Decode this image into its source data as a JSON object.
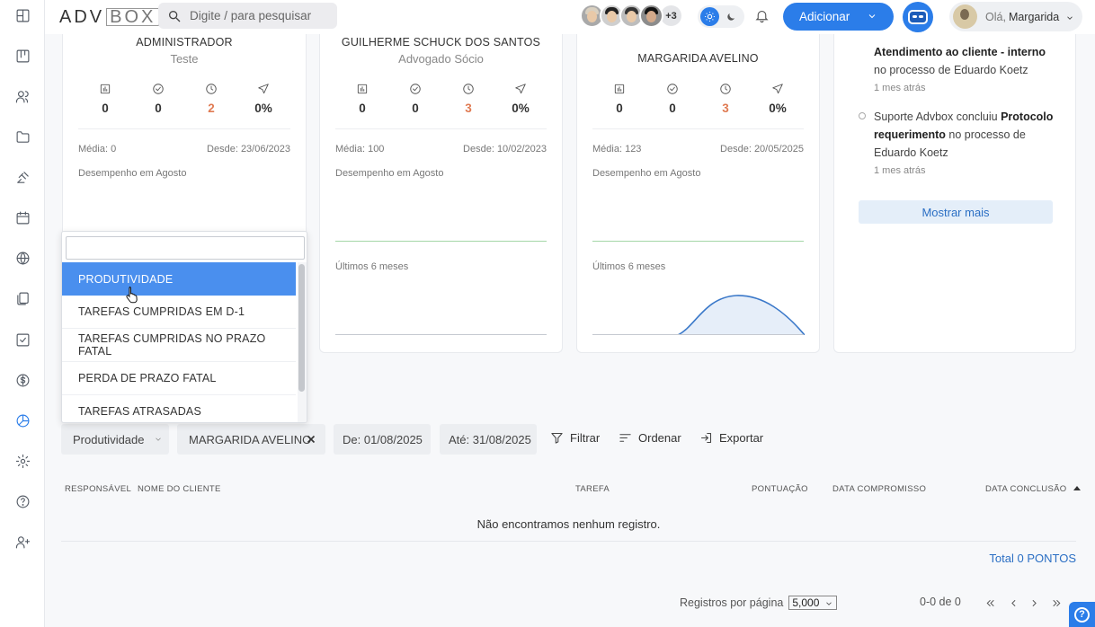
{
  "topbar": {
    "logo_main": "ADV",
    "logo_box": "BOX",
    "search_placeholder": "Digite / para pesquisar",
    "extra_users": "+3",
    "add_label": "Adicionar",
    "greeting": "Olá,",
    "user_name": "Margarida"
  },
  "sidebar": {
    "items": [
      "dashboard-icon",
      "kanban-icon",
      "contacts-icon",
      "folder-icon",
      "gavel-icon",
      "calendar-icon",
      "globe-icon",
      "documents-icon",
      "tasks-icon",
      "finance-icon",
      "reports-icon",
      "settings-icon",
      "help-icon",
      "add-user-icon"
    ],
    "active": "reports-icon"
  },
  "cards": [
    {
      "name": "ADMINISTRADOR",
      "role": "Teste",
      "stats": [
        "0",
        "0",
        "2",
        "0%"
      ],
      "media": "Média: 0",
      "desde": "Desde: 23/06/2023",
      "desempenho": "Desempenho em Agosto",
      "ultimos": ""
    },
    {
      "name": "GUILHERME SCHUCK DOS SANTOS",
      "role": "Advogado Sócio",
      "stats": [
        "0",
        "0",
        "3",
        "0%"
      ],
      "media": "Média: 100",
      "desde": "Desde: 10/02/2023",
      "desempenho": "Desempenho em Agosto",
      "ultimos": "Últimos 6 meses"
    },
    {
      "name": "MARGARIDA AVELINO",
      "role": "",
      "stats": [
        "0",
        "0",
        "3",
        "0%"
      ],
      "media": "Média: 123",
      "desde": "Desde: 20/05/2025",
      "desempenho": "Desempenho em Agosto",
      "ultimos": "Últimos 6 meses"
    }
  ],
  "activity": {
    "item1_bold": "Atendimento ao cliente - interno",
    "item1_text": "no processo de Eduardo Koetz",
    "item1_time": "1 mes atrás",
    "item2_prefix": "Suporte Advbox concluiu ",
    "item2_bold": "Protocolo requerimento",
    "item2_suffix": " no processo de Eduardo Koetz",
    "item2_time": "1 mes atrás",
    "more_label": "Mostrar mais"
  },
  "dropdown": {
    "search_value": "",
    "options": [
      "PRODUTIVIDADE",
      "TAREFAS CUMPRIDAS EM D-1",
      "TAREFAS CUMPRIDAS NO PRAZO FATAL",
      "PERDA DE PRAZO FATAL",
      "TAREFAS ATRASADAS"
    ],
    "selected": "PRODUTIVIDADE"
  },
  "filters": {
    "report_type": "Produtividade",
    "person": "MARGARIDA AVELINO",
    "from": "De: 01/08/2025",
    "to": "Até: 31/08/2025",
    "filter_label": "Filtrar",
    "sort_label": "Ordenar",
    "export_label": "Exportar"
  },
  "table": {
    "headers": [
      "RESPONSÁVEL",
      "NOME DO CLIENTE",
      "TAREFA",
      "PONTUAÇÃO",
      "DATA COMPROMISSO",
      "DATA CONCLUSÃO"
    ],
    "empty_message": "Não encontramos nenhum registro.",
    "total": "Total 0 PONTOS"
  },
  "pagination": {
    "per_page_label": "Registros por página",
    "per_page_value": "5,000",
    "range": "0-0 de 0"
  },
  "colors": {
    "accent": "#2b7de9",
    "orange_value": "#e07b53",
    "selected_option": "#4a8fee"
  }
}
